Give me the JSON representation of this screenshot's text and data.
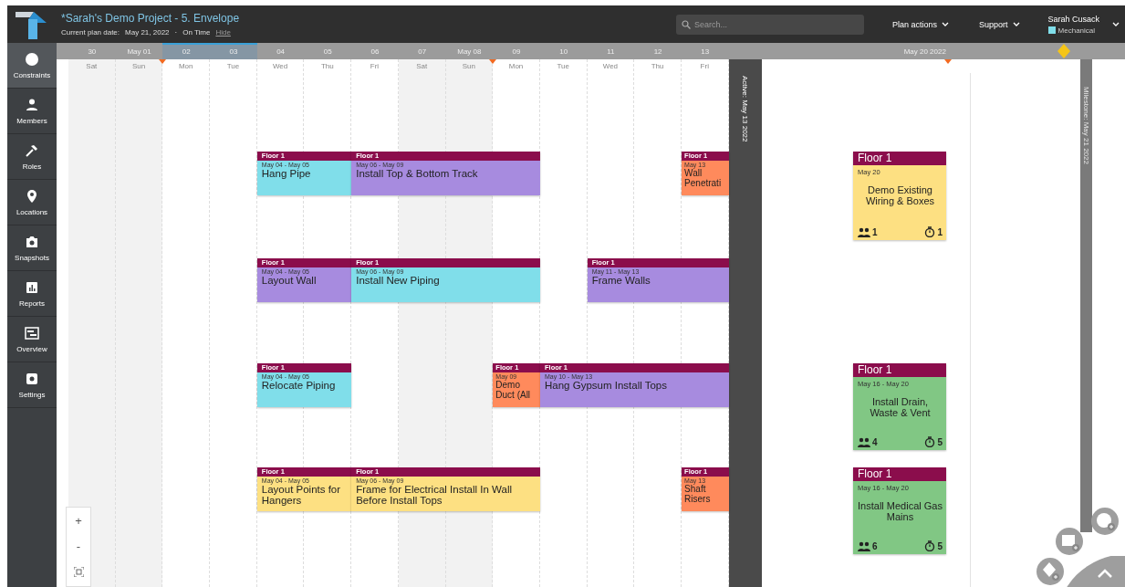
{
  "header": {
    "project_title": "*Sarah's Demo Project - 5. Envelope",
    "plan_date_label": "Current plan date:",
    "plan_date": "May 21, 2022",
    "separator": "·",
    "status": "On Time",
    "hide_link": "Hide"
  },
  "search": {
    "placeholder": "Search..."
  },
  "menus": [
    {
      "label": "Plan actions"
    },
    {
      "label": "Support"
    }
  ],
  "user": {
    "name": "Sarah Cusack",
    "trade": "Mechanical"
  },
  "sidebar": {
    "items": [
      {
        "label": "Constraints",
        "selected": true
      },
      {
        "label": "Members",
        "selected": false
      },
      {
        "label": "Roles",
        "selected": false
      },
      {
        "label": "Locations",
        "selected": false
      },
      {
        "label": "Snapshots",
        "selected": false
      },
      {
        "label": "Reports",
        "selected": false
      },
      {
        "label": "Overview",
        "selected": false
      },
      {
        "label": "Settings",
        "selected": false
      }
    ]
  },
  "timeline": {
    "days": [
      {
        "date": "30",
        "weekday": "Sat",
        "weekend": true,
        "selected": false
      },
      {
        "date": "May 01",
        "weekday": "Sun",
        "weekend": true,
        "selected": false
      },
      {
        "date": "02",
        "weekday": "Mon",
        "weekend": false,
        "selected": true
      },
      {
        "date": "03",
        "weekday": "Tue",
        "weekend": false,
        "selected": true
      },
      {
        "date": "04",
        "weekday": "Wed",
        "weekend": false,
        "selected": false
      },
      {
        "date": "05",
        "weekday": "Thu",
        "weekend": false,
        "selected": false
      },
      {
        "date": "06",
        "weekday": "Fri",
        "weekend": false,
        "selected": false
      },
      {
        "date": "07",
        "weekday": "Sat",
        "weekend": true,
        "selected": false
      },
      {
        "date": "May 08",
        "weekday": "Sun",
        "weekend": true,
        "selected": false
      },
      {
        "date": "09",
        "weekday": "Mon",
        "weekend": false,
        "selected": false
      },
      {
        "date": "10",
        "weekday": "Tue",
        "weekend": false,
        "selected": false
      },
      {
        "date": "11",
        "weekday": "Wed",
        "weekend": false,
        "selected": false
      },
      {
        "date": "12",
        "weekday": "Thu",
        "weekend": false,
        "selected": false
      },
      {
        "date": "13",
        "weekday": "Fri",
        "weekend": false,
        "selected": false
      }
    ],
    "active_marker": "Active: May 13 2022",
    "future_label": "May 20 2022",
    "milestone_marker": "Milestone: May 21 2022"
  },
  "lanes": [
    {
      "cards": [
        {
          "zone": "Floor 1",
          "dates": "May 04 - May 05",
          "title": "Hang Pipe",
          "color": "#80deea"
        },
        {
          "zone": "Floor 1",
          "dates": "May 06 - May 09",
          "title": "Install Top & Bottom Track",
          "color": "#a78bdf"
        },
        {
          "zone": "Floor 1",
          "dates": "May 13",
          "title": "Wall Penetrati",
          "color": "#ff8a5c"
        }
      ]
    },
    {
      "cards": [
        {
          "zone": "Floor 1",
          "dates": "May 04 - May 05",
          "title": "Layout Wall",
          "color": "#a78bdf"
        },
        {
          "zone": "Floor 1",
          "dates": "May 06 - May 09",
          "title": "Install New Piping",
          "color": "#80deea"
        },
        {
          "zone": "Floor 1",
          "dates": "May 11 - May 13",
          "title": "Frame Walls",
          "color": "#a78bdf"
        }
      ]
    },
    {
      "cards": [
        {
          "zone": "Floor 1",
          "dates": "May 04 - May 05",
          "title": "Relocate Piping",
          "color": "#80deea"
        },
        {
          "zone": "Floor 1",
          "dates": "May 09",
          "title": "Demo Duct (All",
          "color": "#ff8a5c"
        },
        {
          "zone": "Floor 1",
          "dates": "May 10 - May 13",
          "title": "Hang Gypsum Install Tops",
          "color": "#a78bdf"
        }
      ]
    },
    {
      "cards": [
        {
          "zone": "Floor 1",
          "dates": "May 04 - May 05",
          "title": "Layout Points for Hangers",
          "color": "#fde082"
        },
        {
          "zone": "Floor 1",
          "dates": "May 06 - May 09",
          "title": "Frame for Electrical Install In Wall Before Install Tops",
          "color": "#fde082"
        },
        {
          "zone": "Floor 1",
          "dates": "May 13",
          "title": "Shaft Risers",
          "color": "#ff8a5c"
        }
      ]
    }
  ],
  "side_cards": [
    {
      "zone": "Floor 1",
      "dates": "May 20",
      "title": "Demo Existing Wiring & Boxes",
      "crew": "1",
      "duration": "1",
      "color": "#fde082"
    },
    {
      "zone": "Floor 1",
      "dates": "May 16 - May 20",
      "title": "Install Drain, Waste & Vent",
      "crew": "4",
      "duration": "5",
      "color": "#81c784"
    },
    {
      "zone": "Floor 1",
      "dates": "May 16 - May 20",
      "title": "Install Medical Gas Mains",
      "crew": "6",
      "duration": "5",
      "color": "#81c784"
    }
  ],
  "zoom_controls": [
    "+",
    "-"
  ]
}
